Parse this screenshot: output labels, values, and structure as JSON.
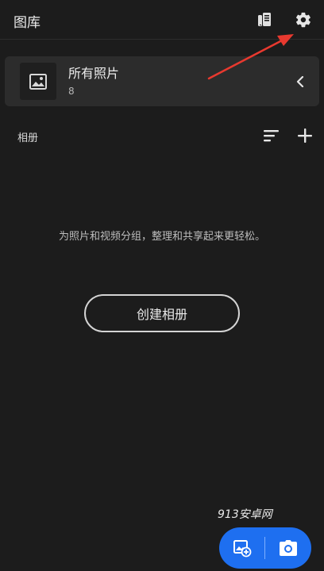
{
  "header": {
    "title": "图库",
    "icons": {
      "cloud": "cloud-storage-icon",
      "settings": "gear-icon"
    }
  },
  "all_photos": {
    "title": "所有照片",
    "count": "8",
    "icon": "image-icon"
  },
  "albums": {
    "label": "相册",
    "sort_icon": "sort-icon",
    "add_icon": "plus-icon",
    "empty_message": "为照片和视频分组，整理和共享起来更轻松。",
    "create_label": "创建相册"
  },
  "watermark": "913安卓网",
  "fab": {
    "import_icon": "add-photo-icon",
    "camera_icon": "camera-icon"
  },
  "colors": {
    "background": "#1c1c1c",
    "card": "#2c2c2c",
    "accent": "#1e6ff0",
    "annotation_arrow": "#e8392f"
  }
}
